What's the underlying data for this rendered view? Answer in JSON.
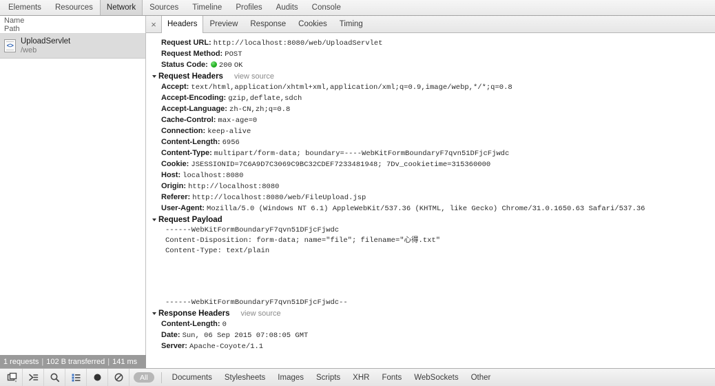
{
  "panel_tabs": [
    {
      "label": "Elements",
      "selected": false
    },
    {
      "label": "Resources",
      "selected": false
    },
    {
      "label": "Network",
      "selected": true
    },
    {
      "label": "Sources",
      "selected": false
    },
    {
      "label": "Timeline",
      "selected": false
    },
    {
      "label": "Profiles",
      "selected": false
    },
    {
      "label": "Audits",
      "selected": false
    },
    {
      "label": "Console",
      "selected": false
    }
  ],
  "sidebar": {
    "column_name": "Name",
    "column_path": "Path",
    "request": {
      "name": "UploadServlet",
      "path": "/web",
      "icon": "document-code-icon",
      "icon_glyph": "<>"
    },
    "summary": {
      "requests": "1 requests",
      "transferred": "102 B transferred",
      "time": "141 ms",
      "separator": "|"
    }
  },
  "detail": {
    "close_label": "×",
    "tabs": [
      {
        "label": "Headers",
        "selected": true
      },
      {
        "label": "Preview",
        "selected": false
      },
      {
        "label": "Response",
        "selected": false
      },
      {
        "label": "Cookies",
        "selected": false
      },
      {
        "label": "Timing",
        "selected": false
      }
    ],
    "general": [
      {
        "key": "Request URL:",
        "value": "http://localhost:8080/web/UploadServlet"
      },
      {
        "key": "Request Method:",
        "value": "POST"
      }
    ],
    "status": {
      "key": "Status Code:",
      "code": "200",
      "text": "OK",
      "dot_color": "#23b223"
    },
    "request_headers_section": {
      "title": "Request Headers",
      "view_source": "view source"
    },
    "request_headers": [
      {
        "key": "Accept:",
        "value": "text/html,application/xhtml+xml,application/xml;q=0.9,image/webp,*/*;q=0.8"
      },
      {
        "key": "Accept-Encoding:",
        "value": "gzip,deflate,sdch"
      },
      {
        "key": "Accept-Language:",
        "value": "zh-CN,zh;q=0.8"
      },
      {
        "key": "Cache-Control:",
        "value": "max-age=0"
      },
      {
        "key": "Connection:",
        "value": "keep-alive"
      },
      {
        "key": "Content-Length:",
        "value": "6956"
      },
      {
        "key": "Content-Type:",
        "value": "multipart/form-data; boundary=----WebKitFormBoundaryF7qvn51DFjcFjwdc"
      },
      {
        "key": "Cookie:",
        "value": "JSESSIONID=7C6A9D7C3069C9BC32CDEF7233481948; 7Dv_cookietime=315360000"
      },
      {
        "key": "Host:",
        "value": "localhost:8080"
      },
      {
        "key": "Origin:",
        "value": "http://localhost:8080"
      },
      {
        "key": "Referer:",
        "value": "http://localhost:8080/web/FileUpload.jsp"
      },
      {
        "key": "User-Agent:",
        "value": "Mozilla/5.0 (Windows NT 6.1) AppleWebKit/537.36 (KHTML, like Gecko) Chrome/31.0.1650.63 Safari/537.36"
      }
    ],
    "request_payload_section": {
      "title": "Request Payload"
    },
    "request_payload": [
      "------WebKitFormBoundaryF7qvn51DFjcFjwdc",
      "Content-Disposition: form-data; name=\"file\"; filename=\"心得.txt\"",
      "Content-Type: text/plain",
      "",
      "",
      "------WebKitFormBoundaryF7qvn51DFjcFjwdc--"
    ],
    "response_headers_section": {
      "title": "Response Headers",
      "view_source": "view source"
    },
    "response_headers": [
      {
        "key": "Content-Length:",
        "value": "0"
      },
      {
        "key": "Date:",
        "value": "Sun, 06 Sep 2015 07:08:05 GMT"
      },
      {
        "key": "Server:",
        "value": "Apache-Coyote/1.1"
      }
    ]
  },
  "statusbar": {
    "buttons": [
      {
        "name": "dock-side-icon"
      },
      {
        "name": "console-drawer-icon"
      },
      {
        "name": "search-icon"
      },
      {
        "name": "large-rows-icon"
      },
      {
        "name": "record-icon"
      },
      {
        "name": "clear-icon"
      }
    ],
    "all_filter": "All",
    "filters": [
      "Documents",
      "Stylesheets",
      "Images",
      "Scripts",
      "XHR",
      "Fonts",
      "WebSockets",
      "Other"
    ]
  }
}
